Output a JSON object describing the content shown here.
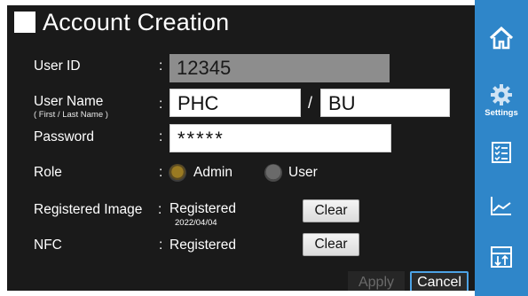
{
  "screen": {
    "title": "Account Creation"
  },
  "form": {
    "user_id": {
      "label": "User ID",
      "value": "12345"
    },
    "user_name": {
      "label": "User Name",
      "sublabel": "( First / Last Name )",
      "first": "PHC",
      "separator": "/",
      "last": "BU"
    },
    "password": {
      "label": "Password",
      "value": "*****"
    },
    "role": {
      "label": "Role",
      "options": [
        {
          "label": "Admin",
          "selected": true
        },
        {
          "label": "User",
          "selected": false
        }
      ]
    },
    "registered_image": {
      "label": "Registered Image",
      "status": "Registered",
      "date": "2022/04/04",
      "clear_label": "Clear"
    },
    "nfc": {
      "label": "NFC",
      "status": "Registered",
      "clear_label": "Clear"
    },
    "colon": ":"
  },
  "footer": {
    "apply_label": "Apply",
    "cancel_label": "Cancel"
  },
  "sidebar": {
    "items": [
      {
        "icon": "home-icon",
        "label": ""
      },
      {
        "icon": "gear-icon",
        "label": "Settings",
        "active": true
      },
      {
        "icon": "checklist-icon",
        "label": ""
      },
      {
        "icon": "line-chart-icon",
        "label": ""
      },
      {
        "icon": "sort-transfer-icon",
        "label": ""
      }
    ]
  },
  "colors": {
    "sidebar": "#2f86c9",
    "background": "#1a1a1a",
    "readonly_field": "#8d8d8d",
    "accent": "#4da3e6"
  }
}
